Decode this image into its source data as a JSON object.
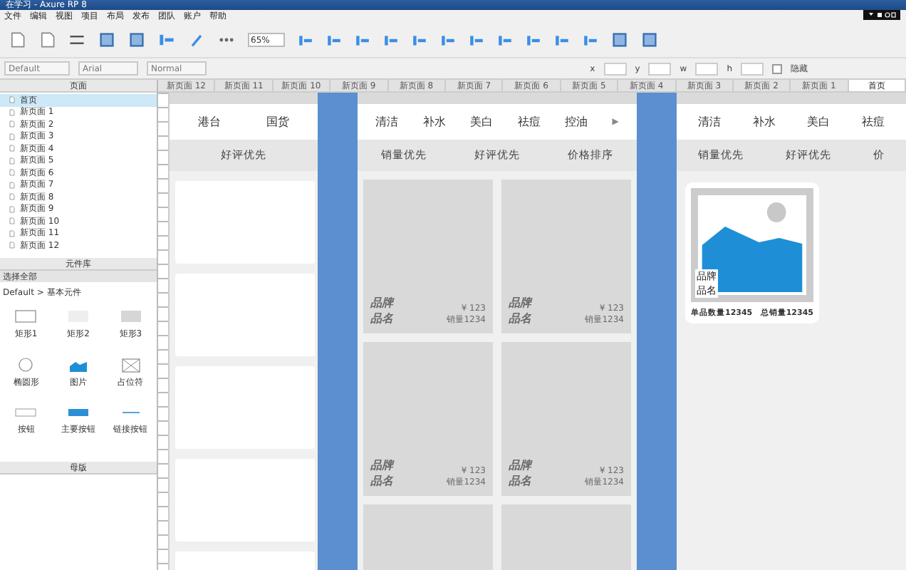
{
  "window": {
    "title": "在学习 - Axure RP 8"
  },
  "menu": [
    "文件",
    "编辑",
    "视图",
    "项目",
    "布局",
    "发布",
    "团队",
    "账户",
    "帮助"
  ],
  "toolbar": {
    "zoom": "65%"
  },
  "format_bar": {
    "style": "Default",
    "font": "Arial",
    "weight": "Normal",
    "fields": [
      "x",
      "y",
      "w",
      "h"
    ],
    "hidden": {
      "label": "隐藏",
      "checked": false
    }
  },
  "pages_panel": {
    "title": "页面",
    "pages": [
      {
        "label": "首页",
        "selected": true
      },
      {
        "label": "新页面 1",
        "selected": false
      },
      {
        "label": "新页面 2",
        "selected": false
      },
      {
        "label": "新页面 3",
        "selected": false
      },
      {
        "label": "新页面 4",
        "selected": false
      },
      {
        "label": "新页面 5",
        "selected": false
      },
      {
        "label": "新页面 6",
        "selected": false
      },
      {
        "label": "新页面 7",
        "selected": false
      },
      {
        "label": "新页面 8",
        "selected": false
      },
      {
        "label": "新页面 9",
        "selected": false
      },
      {
        "label": "新页面 10",
        "selected": false
      },
      {
        "label": "新页面 11",
        "selected": false
      },
      {
        "label": "新页面 12",
        "selected": false
      }
    ]
  },
  "library_panel": {
    "title": "元件库",
    "filter": "选择全部",
    "group": "Default > 基本元件",
    "widgets": [
      {
        "label": "矩形1",
        "kind": "rect-white"
      },
      {
        "label": "矩形2",
        "kind": "rect-light"
      },
      {
        "label": "矩形3",
        "kind": "rect-gray"
      },
      {
        "label": "椭圆形",
        "kind": "ellipse"
      },
      {
        "label": "图片",
        "kind": "image"
      },
      {
        "label": "占位符",
        "kind": "placeholder"
      },
      {
        "label": "按钮",
        "kind": "button"
      },
      {
        "label": "主要按钮",
        "kind": "primary"
      },
      {
        "label": "链接按钮",
        "kind": "link"
      }
    ]
  },
  "masters_panel": {
    "title": "母版"
  },
  "doc_tabs": [
    {
      "label": "新页面 12",
      "selected": false
    },
    {
      "label": "新页面 11",
      "selected": false
    },
    {
      "label": "新页面 10",
      "selected": false
    },
    {
      "label": "新页面 9",
      "selected": false
    },
    {
      "label": "新页面 8",
      "selected": false
    },
    {
      "label": "新页面 7",
      "selected": false
    },
    {
      "label": "新页面 6",
      "selected": false
    },
    {
      "label": "新页面 5",
      "selected": false
    },
    {
      "label": "新页面 4",
      "selected": false
    },
    {
      "label": "新页面 3",
      "selected": false
    },
    {
      "label": "新页面 2",
      "selected": false
    },
    {
      "label": "新页面 1",
      "selected": false
    },
    {
      "label": "首页",
      "selected": true
    }
  ],
  "frames": [
    {
      "categories": [
        "港台",
        "国货"
      ],
      "sorts": [
        "好评优先"
      ]
    },
    {
      "categories": [
        "清洁",
        "补水",
        "美白",
        "祛痘",
        "控油"
      ],
      "more": "▶",
      "sorts": [
        "销量优先",
        "好评优先",
        "价格排序"
      ],
      "products": [
        {
          "kind": "text",
          "brand": "品牌",
          "name": "品名",
          "price": "¥ 123",
          "sales": "销量1234"
        },
        {
          "kind": "text",
          "brand": "品牌",
          "name": "品名",
          "price": "¥ 123",
          "sales": "销量1234"
        },
        {
          "kind": "text",
          "brand": "品牌",
          "name": "品名",
          "price": "¥ 123",
          "sales": "销量1234"
        },
        {
          "kind": "text",
          "brand": "品牌",
          "name": "品名",
          "price": "¥ 123",
          "sales": "销量1234"
        },
        {
          "kind": "blank"
        },
        {
          "kind": "blank"
        }
      ]
    },
    {
      "categories": [
        "清洁",
        "补水",
        "美白",
        "祛痘"
      ],
      "sorts": [
        "销量优先",
        "好评优先",
        "价"
      ],
      "detail": {
        "brand": "品牌",
        "name": "品名",
        "quantity": "单品数量12345",
        "total": "总销量12345"
      }
    }
  ]
}
